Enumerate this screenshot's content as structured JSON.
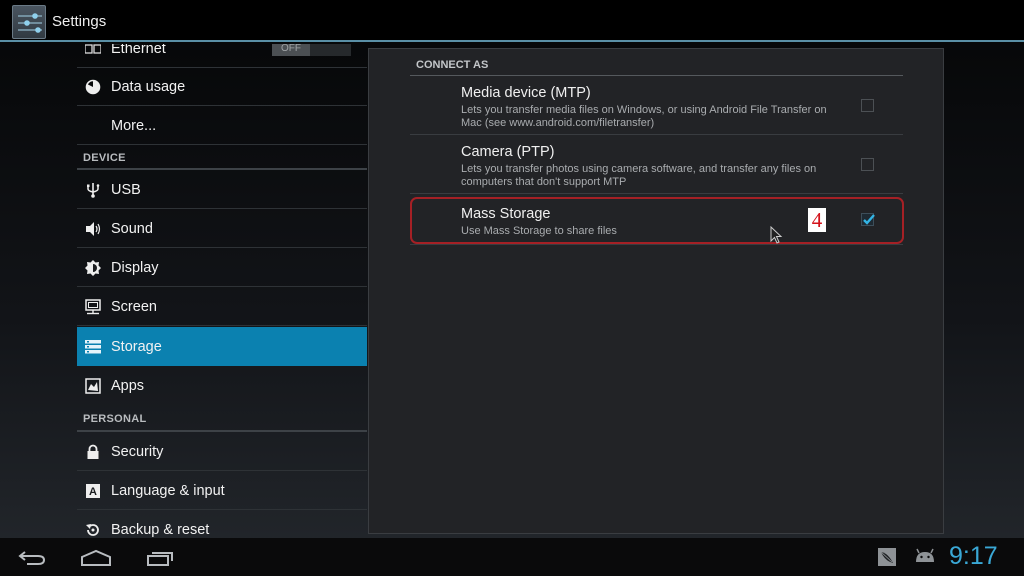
{
  "header": {
    "title": "Settings",
    "app_icon": "settings-sliders-icon"
  },
  "sidebar": {
    "sections": {
      "device": "DEVICE",
      "personal": "PERSONAL"
    },
    "items": [
      {
        "label": "Ethernet",
        "icon": "ethernet-icon",
        "toggle": "OFF"
      },
      {
        "label": "Data usage",
        "icon": "data-usage-icon"
      },
      {
        "label": "More...",
        "icon": ""
      },
      {
        "label": "USB",
        "icon": "usb-icon"
      },
      {
        "label": "Sound",
        "icon": "speaker-icon"
      },
      {
        "label": "Display",
        "icon": "brightness-icon"
      },
      {
        "label": "Screen",
        "icon": "monitor-icon"
      },
      {
        "label": "Storage",
        "icon": "storage-icon",
        "selected": true
      },
      {
        "label": "Apps",
        "icon": "apps-icon"
      },
      {
        "label": "Security",
        "icon": "lock-icon"
      },
      {
        "label": "Language & input",
        "icon": "keyboard-a-icon"
      },
      {
        "label": "Backup & reset",
        "icon": "backup-icon"
      }
    ]
  },
  "main": {
    "section_header": "CONNECT AS",
    "options": [
      {
        "title": "Media device (MTP)",
        "summary": "Lets you transfer media files on Windows, or using Android File Transfer on Mac (see www.android.com/filetransfer)",
        "checked": false
      },
      {
        "title": "Camera (PTP)",
        "summary": "Lets you transfer photos using camera software, and transfer any files on computers that don't support MTP",
        "checked": false
      },
      {
        "title": "Mass Storage",
        "summary": "Use Mass Storage to share files",
        "checked": true
      }
    ],
    "annotation_label": "4",
    "highlight_color": "#a52025"
  },
  "navbar": {
    "buttons": [
      "back",
      "home",
      "recent-apps"
    ],
    "status_icons": [
      "notification-leaf-icon",
      "android-debug-icon"
    ],
    "clock": "9:17"
  },
  "colors": {
    "accent": "#0b81b0",
    "clock": "#3aa8d6",
    "checkmark": "#33b5e5"
  }
}
